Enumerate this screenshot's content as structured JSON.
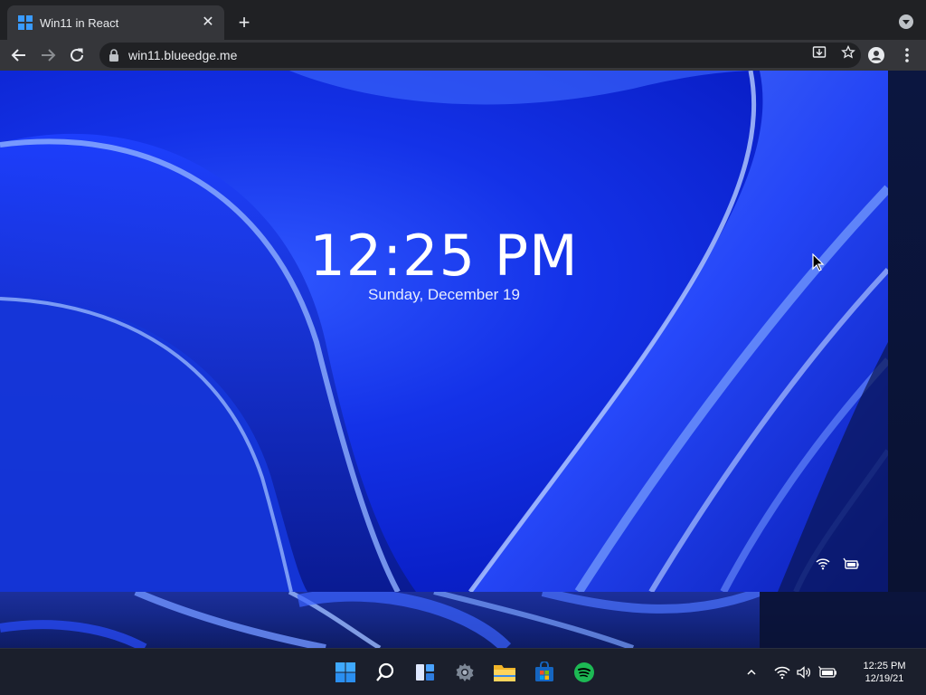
{
  "browser": {
    "tab": {
      "title": "Win11 in React",
      "close_glyph": "✕"
    },
    "new_tab_glyph": "+",
    "url": "win11.blueedge.me",
    "icons": [
      "back-arrow-icon",
      "forward-arrow-icon",
      "reload-icon",
      "lock-icon",
      "install-app-icon",
      "star-icon",
      "profile-icon",
      "menu-dots-icon",
      "tab-search-icon"
    ]
  },
  "lock_screen": {
    "time": "12:25 PM",
    "date": "Sunday, December 19",
    "status_icons": [
      "wifi-icon",
      "battery-charging-icon"
    ]
  },
  "taskbar": {
    "apps": [
      "start-icon",
      "search-icon",
      "widgets-icon",
      "settings-icon",
      "file-explorer-icon",
      "store-icon",
      "spotify-icon"
    ],
    "tray": {
      "chevron_glyph": "^",
      "icons": [
        "wifi-icon",
        "volume-icon",
        "battery-icon"
      ],
      "time": "12:25 PM",
      "date": "12/19/21"
    }
  },
  "colors": {
    "wallpaper_blue": "#1432e8",
    "chrome_dark": "#202124",
    "chrome_toolbar": "#35363a",
    "taskbar": "#1b1f2c",
    "spotify_green": "#1db954"
  }
}
